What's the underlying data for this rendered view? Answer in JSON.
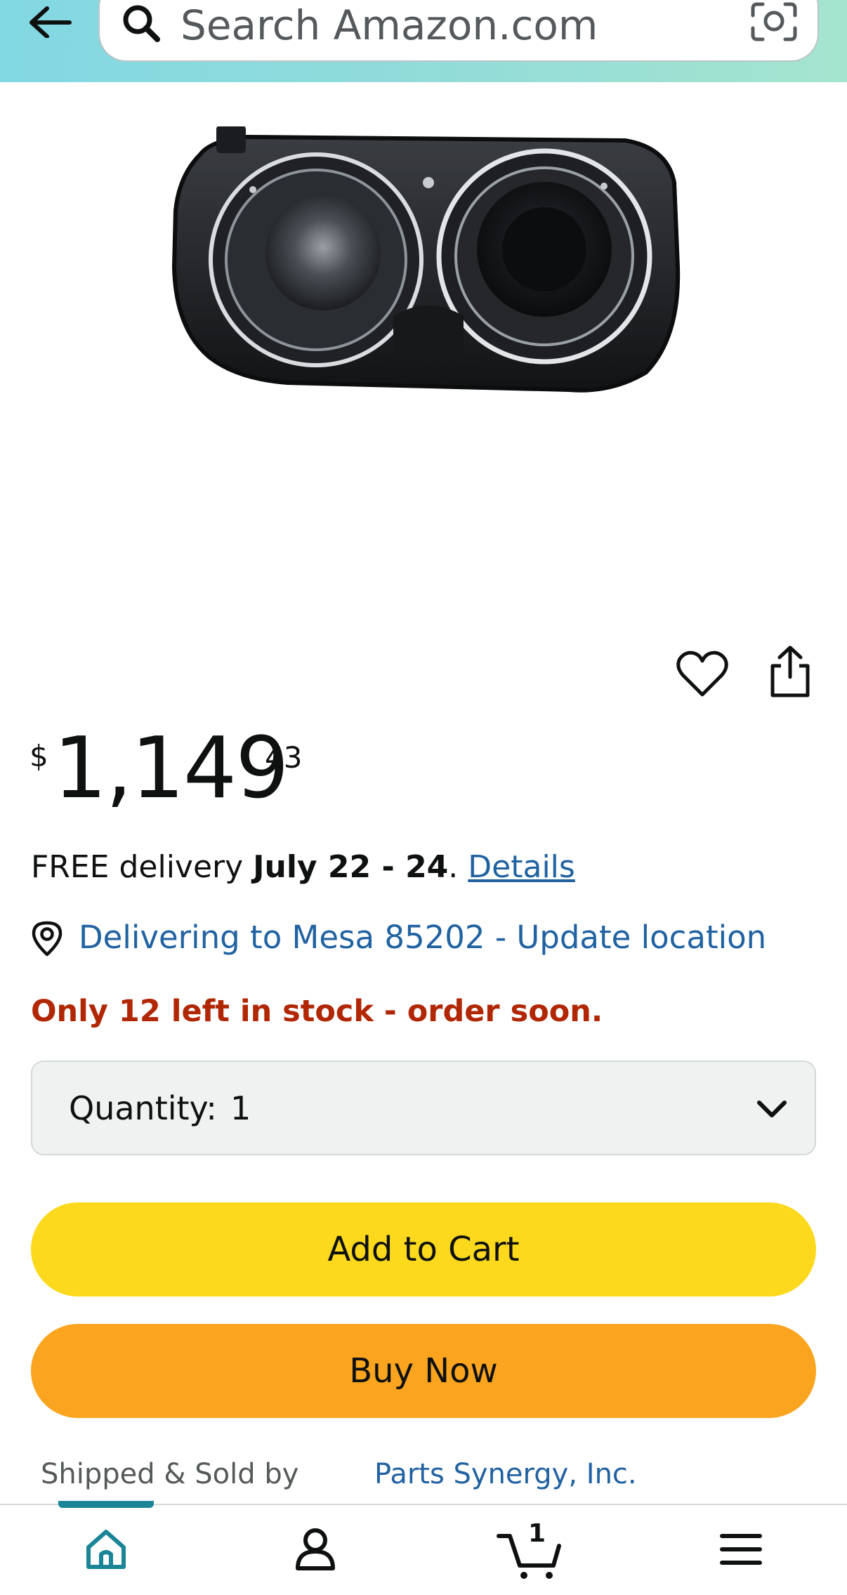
{
  "header": {
    "search_placeholder": "Search Amazon.com",
    "accent_color": "#82d8e3",
    "icons": {
      "back": "arrow-left-icon",
      "search": "magnifier-icon",
      "camera": "camera-icon"
    }
  },
  "product": {
    "image_alt": "headlight",
    "price": {
      "symbol": "$",
      "whole": "1,149",
      "fraction": "43"
    },
    "actions": {
      "wishlist_icon": "heart-icon",
      "share_icon": "share-icon"
    }
  },
  "delivery": {
    "prefix": "FREE delivery ",
    "dates": "July 22 - 24",
    "suffix": ". ",
    "details_link": "Details"
  },
  "location": {
    "text": "Delivering to Mesa 85202 - Update location",
    "icon": "location-pin-icon"
  },
  "stock": {
    "text": "Only 12 left in stock - order soon.",
    "color": "#b12704"
  },
  "quantity": {
    "label": "Quantity:",
    "value": "1"
  },
  "buttons": {
    "add_to_cart": "Add to Cart",
    "buy_now": "Buy Now",
    "add_to_cart_color": "#fcd91c",
    "buy_now_color": "#fba41f"
  },
  "seller": {
    "label": "Shipped & Sold by",
    "name": "Parts Synergy, Inc."
  },
  "bottom_nav": {
    "items": [
      {
        "name": "home",
        "icon": "home-icon",
        "active": true
      },
      {
        "name": "account",
        "icon": "person-icon",
        "active": false
      },
      {
        "name": "cart",
        "icon": "cart-icon",
        "active": false
      },
      {
        "name": "menu",
        "icon": "hamburger-menu-icon",
        "active": false
      }
    ],
    "cart_count": "1",
    "active_color": "#1a8597"
  }
}
